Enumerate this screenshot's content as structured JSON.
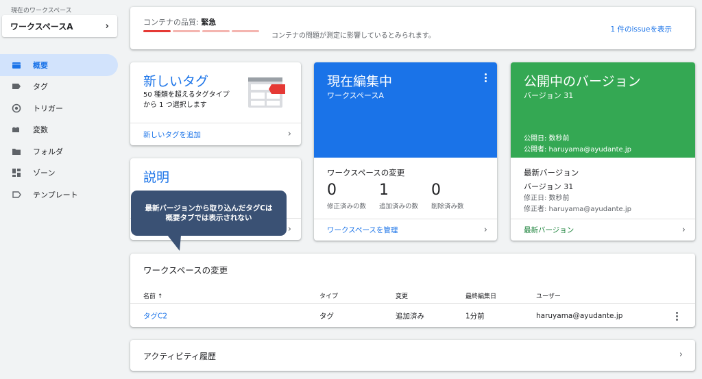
{
  "sidebar": {
    "workspace_label": "現在のワークスペース",
    "workspace_name": "ワークスペースA",
    "items": [
      {
        "label": "概要",
        "icon": "folder-open-icon",
        "active": true
      },
      {
        "label": "タグ",
        "icon": "tag-icon"
      },
      {
        "label": "トリガー",
        "icon": "trigger-icon"
      },
      {
        "label": "変数",
        "icon": "variable-icon"
      },
      {
        "label": "フォルダ",
        "icon": "folder-icon"
      },
      {
        "label": "ゾーン",
        "icon": "zone-icon"
      },
      {
        "label": "テンプレート",
        "icon": "template-icon"
      }
    ]
  },
  "quality": {
    "label": "コンテナの品質:",
    "status": "緊急",
    "message": "コンテナの問題が測定に影響しているとみられます。",
    "issue_link": "1 件のissueを表示",
    "accent": "#e53935"
  },
  "new_tag": {
    "title": "新しいタグ",
    "description": "50 種類を超えるタグタイプから 1 つ選択します",
    "link": "新しいタグを追加"
  },
  "description": {
    "title": "説明"
  },
  "editing": {
    "title": "現在編集中",
    "workspace": "ワークスペースA",
    "changes_title": "ワークスペースの変更",
    "stats": [
      {
        "value": "0",
        "label": "修正済みの数"
      },
      {
        "value": "1",
        "label": "追加済みの数"
      },
      {
        "value": "0",
        "label": "削除済み数"
      }
    ],
    "link": "ワークスペースを管理",
    "color": "#1a73e8"
  },
  "published": {
    "title": "公開中のバージョン",
    "version": "バージョン 31",
    "published_date": "公開日: 数秒前",
    "published_by": "公開者: haruyama@ayudante.jp",
    "latest_title": "最新バージョン",
    "latest_version": "バージョン 31",
    "modified_date": "修正日: 数秒前",
    "modified_by": "修正者: haruyama@ayudante.jp",
    "link": "最新バージョン",
    "color": "#34a853"
  },
  "changes": {
    "title": "ワークスペースの変更",
    "columns": [
      "名前 ↑",
      "タイプ",
      "変更",
      "最終編集日",
      "ユーザー"
    ],
    "rows": [
      {
        "name": "タグC2",
        "type": "タグ",
        "change": "追加済み",
        "edited": "1分前",
        "user": "haruyama@ayudante.jp"
      }
    ]
  },
  "activity": {
    "title": "アクティビティ履歴"
  },
  "callout": {
    "line1": "最新バージョンから取り込んだタグCは",
    "line2": "概要タブでは表示されない",
    "color": "#3a5174"
  }
}
